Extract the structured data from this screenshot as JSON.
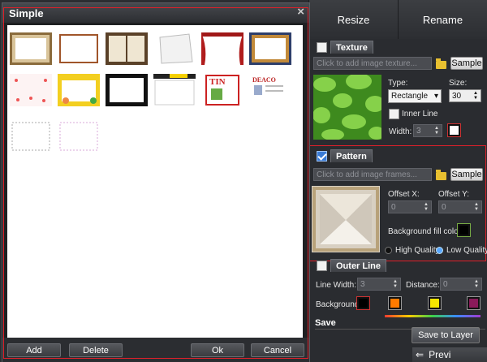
{
  "top_tabs": [
    {
      "label": "Resize"
    },
    {
      "label": "Rename"
    }
  ],
  "texture": {
    "section_label": "Texture",
    "input_placeholder": "Click to add image texture...",
    "sample_label": "Sample",
    "type_label": "Type:",
    "type_value": "Rectangle",
    "size_label": "Size:",
    "size_value": "30",
    "inner_line_label": "Inner Line",
    "width_label": "Width:",
    "width_value": "3"
  },
  "pattern": {
    "section_label": "Pattern",
    "input_placeholder": "Click to add image frames...",
    "sample_label": "Sample",
    "offset_x_label": "Offset X:",
    "offset_x_value": "0",
    "offset_y_label": "Offset Y:",
    "offset_y_value": "0",
    "bg_fill_label": "Background fill color:",
    "high_quality_label": "High Quality",
    "low_quality_label": "Low Quality",
    "quality": "low"
  },
  "outer_line": {
    "section_label": "Outer Line",
    "line_width_label": "Line Width:",
    "line_width_value": "3",
    "distance_label": "Distance:",
    "distance_value": "0",
    "background_label": "Background",
    "colors": [
      "#ff7a00",
      "#f6e600",
      "#8a1a5a"
    ]
  },
  "save": {
    "section_label": "Save",
    "save_to_layer_label": "Save to Layer"
  },
  "bottom_partial_label": "Previ",
  "dialog": {
    "title": "Simple",
    "close_glyph": "×",
    "add_label": "Add",
    "delete_label": "Delete",
    "ok_label": "Ok",
    "cancel_label": "Cancel"
  },
  "thumb_texts": {
    "t11": "TIN",
    "t12": "DEACO"
  }
}
